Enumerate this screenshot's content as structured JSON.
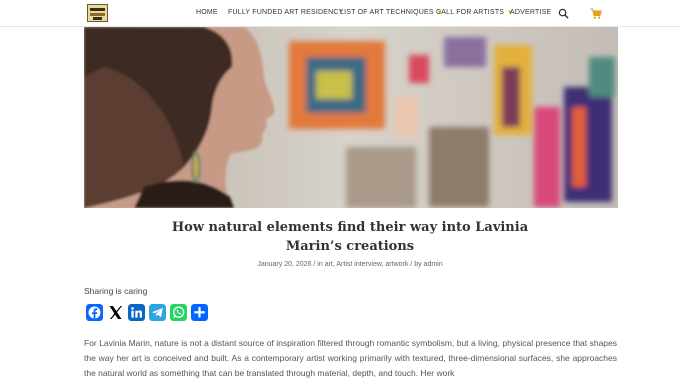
{
  "nav": {
    "home": "HOME",
    "residency": "FULLY FUNDED ART RESIDENCY",
    "techniques": "LIST OF ART TECHNIQUES",
    "call": "CALL FOR ARTISTS",
    "advertise": "ADVERTISE",
    "icons": [
      "search-icon",
      "cart-icon",
      "chevron-down-icon"
    ],
    "accent_color": "#e3a21a"
  },
  "article": {
    "title": "How natural elements find their way into Lavinia Marin’s creations",
    "meta": {
      "date": "January 20, 2026",
      "sep1": " / in ",
      "cat1": "art",
      "comma1": ", ",
      "cat2": "Artist interview",
      "comma2": ", ",
      "cat3": "artwork",
      "sep2": " / by ",
      "author": "admin"
    },
    "sharing_label": "Sharing is caring",
    "share_buttons": [
      {
        "name": "facebook",
        "color": "#0866ff"
      },
      {
        "name": "x",
        "color": "#000000"
      },
      {
        "name": "linkedin",
        "color": "#0a66c2"
      },
      {
        "name": "telegram",
        "color": "#2ca5e0"
      },
      {
        "name": "whatsapp",
        "color": "#25d366"
      },
      {
        "name": "share",
        "color": "#0166ff"
      }
    ],
    "body": "For Lavinia Marin, nature is not a distant source of inspiration filtered through romantic symbolism, but a living, physical presence that shapes the way her art is conceived and built. As a contemporary artist working primarily with textured, three-dimensional surfaces, she approaches the natural world as something that can be translated through material, depth, and touch. Her work"
  }
}
